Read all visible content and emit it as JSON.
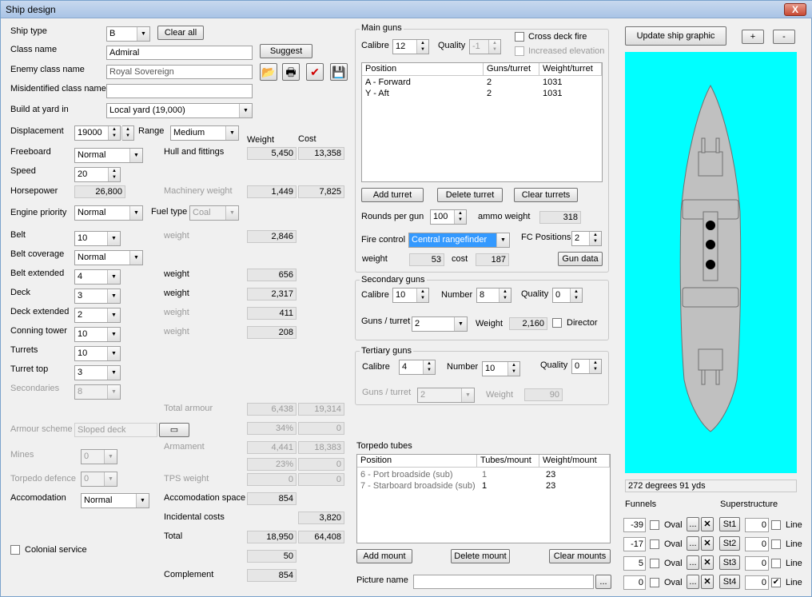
{
  "window": {
    "title": "Ship design",
    "close": "X"
  },
  "left": {
    "ship_type": {
      "label": "Ship type",
      "value": "B"
    },
    "clear_all": "Clear all",
    "class_name": {
      "label": "Class name",
      "value": "Admiral"
    },
    "suggest": "Suggest",
    "enemy_class": {
      "label": "Enemy class name",
      "value": "Royal Sovereign"
    },
    "misidentified": {
      "label": "Misidentified class name",
      "value": ""
    },
    "build_at": {
      "label": "Build at yard in",
      "value": "Local yard (19,000)"
    },
    "displacement": {
      "label": "Displacement",
      "value": "19000"
    },
    "range": {
      "label": "Range",
      "value": "Medium"
    },
    "col_weight": "Weight",
    "col_cost": "Cost",
    "freeboard": {
      "label": "Freeboard",
      "value": "Normal"
    },
    "hull": {
      "label": "Hull and fittings",
      "weight": "5,450",
      "cost": "13,358"
    },
    "speed": {
      "label": "Speed",
      "value": "20"
    },
    "horsepower": {
      "label": "Horsepower",
      "value": "26,800"
    },
    "machinery": {
      "label": "Machinery weight",
      "weight": "1,449",
      "cost": "7,825"
    },
    "engine_priority": {
      "label": "Engine priority",
      "value": "Normal"
    },
    "fuel_type": {
      "label": "Fuel type",
      "value": "Coal"
    },
    "belt": {
      "label": "Belt",
      "value": "10",
      "wlabel": "weight",
      "weight": "2,846"
    },
    "belt_coverage": {
      "label": "Belt coverage",
      "value": "Normal"
    },
    "belt_extended": {
      "label": "Belt extended",
      "value": "4",
      "wlabel": "weight",
      "weight": "656"
    },
    "deck": {
      "label": "Deck",
      "value": "3",
      "wlabel": "weight",
      "weight": "2,317"
    },
    "deck_extended": {
      "label": "Deck extended",
      "value": "2",
      "wlabel": "weight",
      "weight": "411"
    },
    "conning_tower": {
      "label": "Conning tower",
      "value": "10",
      "wlabel": "weight",
      "weight": "208"
    },
    "turrets": {
      "label": "Turrets",
      "value": "10"
    },
    "turret_top": {
      "label": "Turret top",
      "value": "3"
    },
    "secondaries": {
      "label": "Secondaries",
      "value": "8"
    },
    "total_armour": {
      "label": "Total armour",
      "weight": "6,438",
      "cost": "19,314"
    },
    "armour_scheme": {
      "label": "Armour scheme",
      "value": "Sloped deck",
      "pct": "34%",
      "pct_cost": "0"
    },
    "armament": {
      "label": "Armament",
      "weight": "4,441",
      "cost": "18,383",
      "pct": "23%",
      "pct_cost": "0"
    },
    "mines": {
      "label": "Mines",
      "value": "0"
    },
    "torpedo_defence": {
      "label": "Torpedo defence",
      "value": "0"
    },
    "tps": {
      "label": "TPS weight",
      "weight": "0",
      "cost": "0"
    },
    "accomodation": {
      "label": "Accomodation",
      "value": "Normal"
    },
    "accom_space": {
      "label": "Accomodation space",
      "value": "854"
    },
    "incidental": {
      "label": "Incidental costs",
      "value": "3,820"
    },
    "total": {
      "label": "Total",
      "weight": "18,950",
      "cost": "64,408",
      "extra": "50"
    },
    "colonial": {
      "label": "Colonial service"
    },
    "complement": {
      "label": "Complement",
      "value": "854"
    }
  },
  "main_guns": {
    "title": "Main guns",
    "calibre": {
      "label": "Calibre",
      "value": "12"
    },
    "quality": {
      "label": "Quality",
      "value": "-1"
    },
    "cross_deck": "Cross deck fire",
    "increased_elev": "Increased elevation",
    "headers": [
      "Position",
      "Guns/turret",
      "Weight/turret"
    ],
    "rows": [
      [
        "A - Forward",
        "2",
        "1031"
      ],
      [
        "Y - Aft",
        "2",
        "1031"
      ]
    ],
    "add_turret": "Add turret",
    "delete_turret": "Delete turret",
    "clear_turrets": "Clear turrets",
    "rounds": {
      "label": "Rounds per gun",
      "value": "100"
    },
    "ammo": {
      "label": "ammo weight",
      "value": "318"
    },
    "fire_control": {
      "label": "Fire control",
      "value": "Central rangefinder"
    },
    "fc_positions": {
      "label": "FC Positions",
      "value": "2"
    },
    "fc_weight": {
      "label": "weight",
      "value": "53"
    },
    "fc_cost": {
      "label": "cost",
      "value": "187"
    },
    "gun_data": "Gun data"
  },
  "secondary": {
    "title": "Secondary guns",
    "calibre": {
      "label": "Calibre",
      "value": "10"
    },
    "number": {
      "label": "Number",
      "value": "8"
    },
    "quality": {
      "label": "Quality",
      "value": "0"
    },
    "guns_turret": {
      "label": "Guns / turret",
      "value": "2"
    },
    "weight": {
      "label": "Weight",
      "value": "2,160"
    },
    "director": "Director"
  },
  "tertiary": {
    "title": "Tertiary guns",
    "calibre": {
      "label": "Calibre",
      "value": "4"
    },
    "number": {
      "label": "Number",
      "value": "10"
    },
    "quality": {
      "label": "Quality",
      "value": "0"
    },
    "guns_turret": {
      "label": "Guns / turret",
      "value": "2"
    },
    "weight": {
      "label": "Weight",
      "value": "90"
    }
  },
  "torpedo": {
    "title": "Torpedo tubes",
    "headers": [
      "Position",
      "Tubes/mount",
      "Weight/mount"
    ],
    "rows": [
      [
        "6 - Port broadside (sub)",
        "1",
        "23"
      ],
      [
        "7 - Starboard broadside (sub)",
        "1",
        "23"
      ]
    ],
    "add_mount": "Add mount",
    "delete_mount": "Delete mount",
    "clear_mounts": "Clear mounts",
    "picture_name": "Picture name",
    "browse": "..."
  },
  "right": {
    "update": "Update ship graphic",
    "plus": "+",
    "minus": "-",
    "status": "272 degrees 91 yds",
    "funnels": "Funnels",
    "superstructure": "Superstructure",
    "oval": "Oval",
    "line": "Line",
    "funnel_rows": [
      {
        "val": "-39",
        "st": "St1",
        "sval": "0",
        "line": false
      },
      {
        "val": "-17",
        "st": "St2",
        "sval": "0",
        "line": false
      },
      {
        "val": "5",
        "st": "St3",
        "sval": "0",
        "line": false
      },
      {
        "val": "0",
        "st": "St4",
        "sval": "0",
        "line": true
      }
    ],
    "ship_color": "#c0c0c0",
    "bg_color": "#00ffff"
  }
}
